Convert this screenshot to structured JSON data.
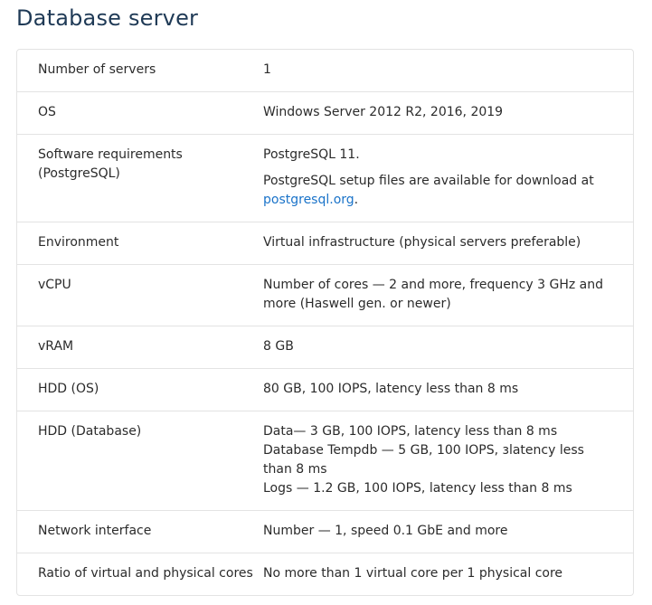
{
  "title": "Database server",
  "rows": {
    "r0": {
      "label": "Number of servers",
      "value": "1"
    },
    "r1": {
      "label": "OS",
      "value": "Windows Server 2012 R2, 2016, 2019"
    },
    "r2": {
      "label": "Software requirements (PostgreSQL)",
      "value_p1": "PostgreSQL 11.",
      "value_p2_text": "PostgreSQL setup files are available for download at ",
      "value_p2_link": "postgresql.org",
      "value_p2_end": "."
    },
    "r3": {
      "label": "Environment",
      "value": "Virtual infrastructure (physical servers preferable)"
    },
    "r4": {
      "label": "vCPU",
      "value": "Number of cores — 2 and more, frequency 3 GHz and more (Haswell gen. or newer)"
    },
    "r5": {
      "label": "vRAM",
      "value": "8 GB"
    },
    "r6": {
      "label": "HDD (OS)",
      "value": "80 GB, 100 IOPS, latency less than 8 ms"
    },
    "r7": {
      "label": "HDD (Database)",
      "line1": "Data— 3  GB, 100 IOPS, latency less than 8 ms",
      "line2": "Database Tempdb — 5  GB, 100 IOPS, зlatency less than 8 ms",
      "line3": "Logs — 1.2 GB, 100 IOPS, latency less than 8 ms"
    },
    "r8": {
      "label": "Network interface",
      "value": "Number — 1, speed 0.1 GbE and more"
    },
    "r9": {
      "label": "Ratio of virtual and physical cores",
      "value": "No more than 1 virtual core per 1 physical core"
    }
  }
}
